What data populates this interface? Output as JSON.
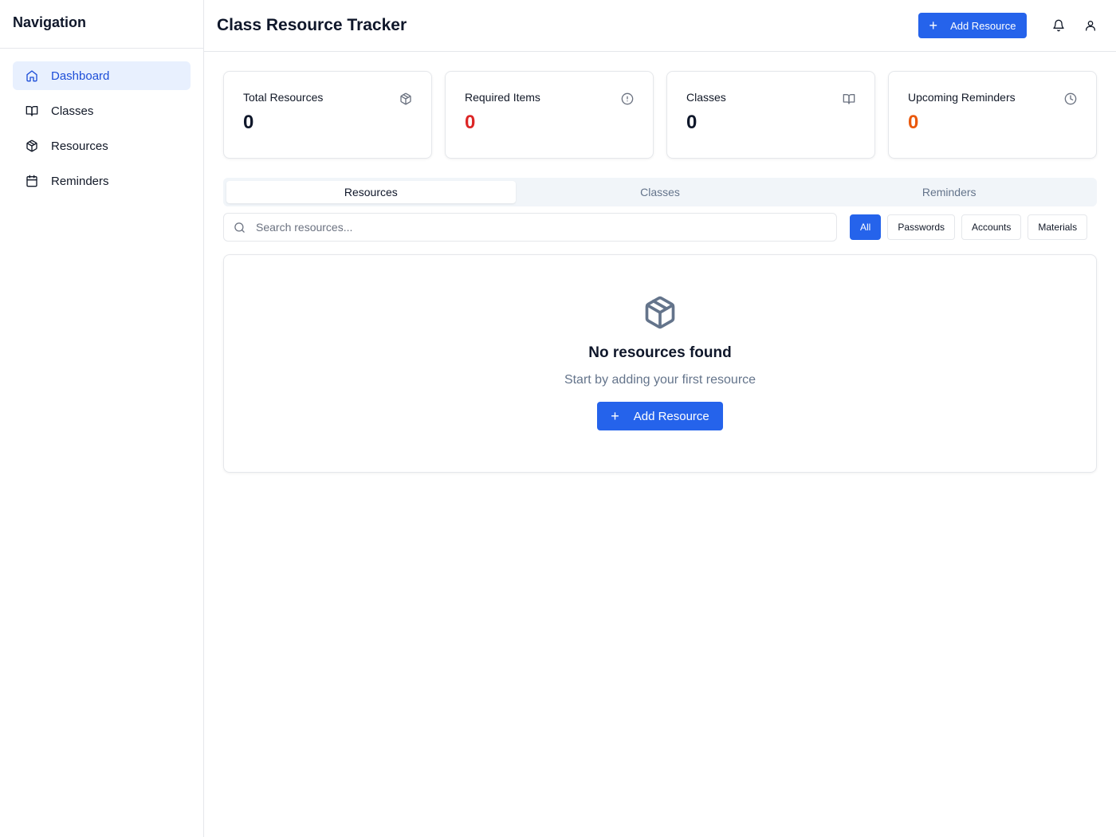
{
  "sidebar": {
    "title": "Navigation",
    "items": [
      {
        "label": "Dashboard",
        "icon": "home-icon",
        "active": true
      },
      {
        "label": "Classes",
        "icon": "book-open-icon"
      },
      {
        "label": "Resources",
        "icon": "package-icon"
      },
      {
        "label": "Reminders",
        "icon": "calendar-icon"
      }
    ]
  },
  "header": {
    "title": "Class Resource Tracker",
    "add_button_label": "Add Resource",
    "icons": [
      "bell-icon",
      "user-icon"
    ]
  },
  "stats": [
    {
      "label": "Total Resources",
      "value": "0",
      "icon": "package-icon",
      "value_color": "#0f172a"
    },
    {
      "label": "Required Items",
      "value": "0",
      "icon": "alert-circle-icon",
      "value_color": "#dc2626"
    },
    {
      "label": "Classes",
      "value": "0",
      "icon": "book-open-icon",
      "value_color": "#0f172a"
    },
    {
      "label": "Upcoming Reminders",
      "value": "0",
      "icon": "clock-icon",
      "value_color": "#ea580c"
    }
  ],
  "tabs": [
    {
      "label": "Resources",
      "active": true
    },
    {
      "label": "Classes"
    },
    {
      "label": "Reminders"
    }
  ],
  "search": {
    "placeholder": "Search resources...",
    "value": ""
  },
  "filters": [
    {
      "label": "All",
      "active": true
    },
    {
      "label": "Passwords"
    },
    {
      "label": "Accounts"
    },
    {
      "label": "Materials"
    }
  ],
  "empty_state": {
    "icon": "package-icon",
    "title": "No resources found",
    "subtitle": "Start by adding your first resource",
    "button_label": "Add Resource"
  },
  "colors": {
    "accent": "#2563eb",
    "active_nav_bg": "#e8f0fe",
    "required": "#dc2626",
    "reminders": "#ea580c"
  }
}
